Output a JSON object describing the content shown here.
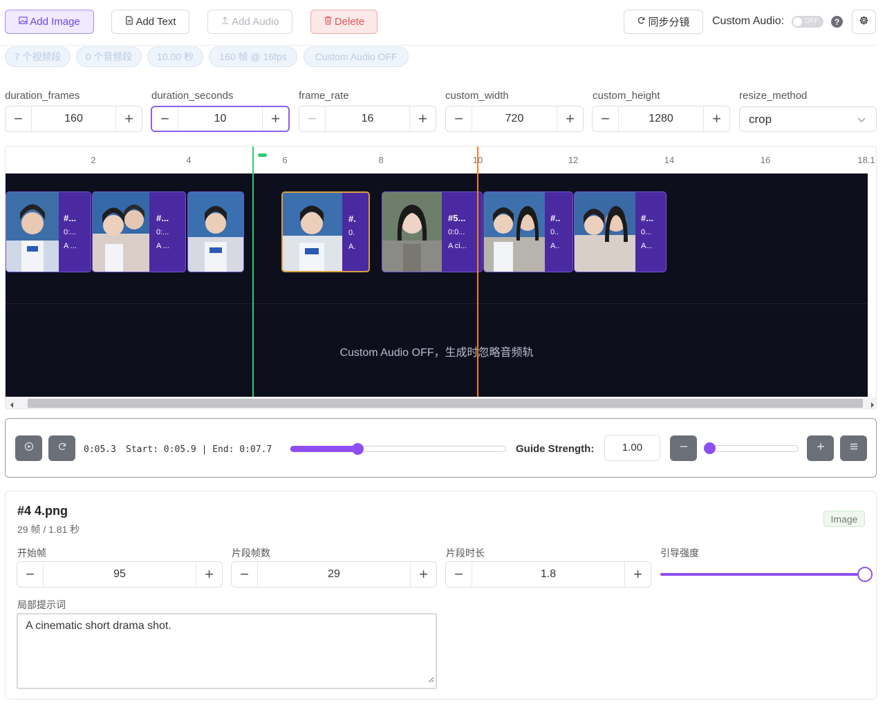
{
  "toolbar": {
    "add_image": "Add Image",
    "add_text": "Add Text",
    "add_audio": "Add Audio",
    "delete": "Delete",
    "sync": "同步分镜",
    "custom_audio_label": "Custom Audio:",
    "toggle_state": "OFF",
    "help": "?"
  },
  "stats": [
    "7 个视频段",
    "0 个音频段",
    "10.00 秒",
    "160 帧 @ 16fps",
    "Custom Audio OFF"
  ],
  "params": {
    "duration_frames": {
      "label": "duration_frames",
      "value": "160"
    },
    "duration_seconds": {
      "label": "duration_seconds",
      "value": "10"
    },
    "frame_rate": {
      "label": "frame_rate",
      "value": "16"
    },
    "custom_width": {
      "label": "custom_width",
      "value": "720"
    },
    "custom_height": {
      "label": "custom_height",
      "value": "1280"
    },
    "resize_method": {
      "label": "resize_method",
      "value": "crop"
    }
  },
  "timeline": {
    "ticks": [
      "2",
      "4",
      "6",
      "8",
      "10",
      "12",
      "14",
      "16",
      "18.1"
    ],
    "clips": [
      {
        "title": "#...",
        "time": "0:...",
        "text": "A ..."
      },
      {
        "title": "#...",
        "time": "0:...",
        "text": "A ..."
      },
      {
        "title": "",
        "time": "",
        "text": ""
      },
      {
        "title": "#.",
        "time": "0.",
        "text": "A."
      },
      {
        "title": "#5...",
        "time": "0:0...",
        "text": "A ci..."
      },
      {
        "title": "#..",
        "time": "0..",
        "text": "A.."
      },
      {
        "title": "#...",
        "time": "0...",
        "text": "A..."
      }
    ],
    "audio_message": "Custom Audio OFF，生成时忽略音频轨"
  },
  "playback": {
    "current_time": "0:05.3",
    "range_text": "Start: 0:05.9 | End: 0:07.7",
    "position_fraction": 0.31,
    "guide_strength_label": "Guide Strength:",
    "guide_strength_value": "1.00"
  },
  "segment": {
    "title": "#4 4.png",
    "subtitle": "29 帧 / 1.81 秒",
    "badge": "Image",
    "start_frame": {
      "label": "开始帧",
      "value": "95"
    },
    "frame_count": {
      "label": "片段帧数",
      "value": "29"
    },
    "duration": {
      "label": "片段时长",
      "value": "1.8"
    },
    "guide_strength": {
      "label": "引导强度",
      "fraction": 1.0
    },
    "prompt_label": "局部提示词",
    "prompt": "A cinematic short drama shot."
  },
  "colors": {
    "accent": "#8d4ff0",
    "playhead_start": "#2ecc71",
    "playhead_end": "#ff7a1a",
    "track_bg": "#0d0f1c",
    "clip_bg": "#4a2aa0"
  }
}
